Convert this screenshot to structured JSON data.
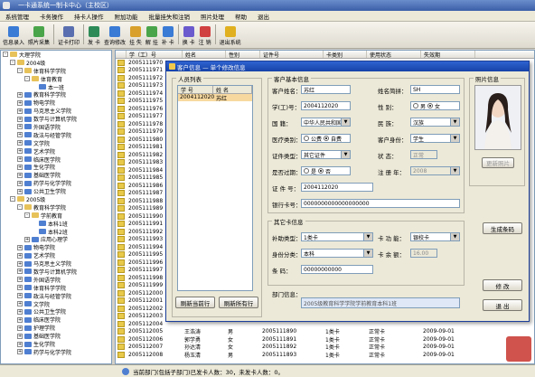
{
  "app": {
    "title": "一卡通系统一制卡中心（主校区）"
  },
  "menu": [
    "系统管理",
    "卡务操作",
    "持卡人操作",
    "附加功能",
    "批量挂失和注销",
    "照片处理",
    "帮助",
    "退出"
  ],
  "toolbar": [
    {
      "label": "信息录入",
      "icon": "user-add-icon",
      "color": "#3a7bd5"
    },
    {
      "label": "照片采集",
      "icon": "camera-icon",
      "color": "#4aa54a"
    },
    {
      "label": "证卡打印",
      "icon": "printer-icon",
      "color": "#5a6fb0"
    },
    {
      "label": "发 卡",
      "icon": "card-issue-icon",
      "color": "#2e8b57"
    },
    {
      "label": "查询修改",
      "icon": "search-icon",
      "color": "#3a7bd5"
    },
    {
      "label": "挂 失",
      "icon": "lock-icon",
      "color": "#d9a12b"
    },
    {
      "label": "解 挂",
      "icon": "unlock-icon",
      "color": "#4aa54a"
    },
    {
      "label": "补 卡",
      "icon": "card-replace-icon",
      "color": "#3a7bd5"
    },
    {
      "label": "换 卡",
      "icon": "card-swap-icon",
      "color": "#6a5acd"
    },
    {
      "label": "注 销",
      "icon": "cancel-icon",
      "color": "#d14040"
    },
    {
      "label": "退出系统",
      "icon": "key-exit-icon",
      "color": "#e0b020"
    }
  ],
  "tree": [
    {
      "text": "大理学院",
      "level": 0,
      "exp": "-"
    },
    {
      "text": "2004级",
      "level": 1,
      "exp": "-"
    },
    {
      "text": "体育科学学院",
      "level": 2,
      "exp": "-"
    },
    {
      "text": "体育教育",
      "level": 3,
      "exp": "-"
    },
    {
      "text": "本一班",
      "level": 4,
      "exp": ""
    },
    {
      "text": "教育科学学院",
      "level": 2,
      "exp": "+"
    },
    {
      "text": "物电学院",
      "level": 2,
      "exp": "+"
    },
    {
      "text": "马克思主义学院",
      "level": 2,
      "exp": "+"
    },
    {
      "text": "数学与计算机学院",
      "level": 2,
      "exp": "+"
    },
    {
      "text": "外国语学院",
      "level": 2,
      "exp": "+"
    },
    {
      "text": "政法与经管学院",
      "level": 2,
      "exp": "+"
    },
    {
      "text": "文学院",
      "level": 2,
      "exp": "+"
    },
    {
      "text": "艺术学院",
      "level": 2,
      "exp": "+"
    },
    {
      "text": "临床医学院",
      "level": 2,
      "exp": "+"
    },
    {
      "text": "生化学院",
      "level": 2,
      "exp": "+"
    },
    {
      "text": "基础医学院",
      "level": 2,
      "exp": "+"
    },
    {
      "text": "药学与化学学院",
      "level": 2,
      "exp": "+"
    },
    {
      "text": "公共卫生学院",
      "level": 2,
      "exp": "+"
    },
    {
      "text": "2005级",
      "level": 1,
      "exp": "-"
    },
    {
      "text": "教育科学学院",
      "level": 2,
      "exp": "-"
    },
    {
      "text": "学前教育",
      "level": 3,
      "exp": "-"
    },
    {
      "text": "本科1班",
      "level": 4,
      "exp": ""
    },
    {
      "text": "本科2班",
      "level": 4,
      "exp": ""
    },
    {
      "text": "应用心理学",
      "level": 3,
      "exp": "+"
    },
    {
      "text": "物电学院",
      "level": 2,
      "exp": "+"
    },
    {
      "text": "艺术学院",
      "level": 2,
      "exp": "+"
    },
    {
      "text": "马克思主义学院",
      "level": 2,
      "exp": "+"
    },
    {
      "text": "数学与计算机学院",
      "level": 2,
      "exp": "+"
    },
    {
      "text": "外国语学院",
      "level": 2,
      "exp": "+"
    },
    {
      "text": "体育科学学院",
      "level": 2,
      "exp": "+"
    },
    {
      "text": "政法与经管学院",
      "level": 2,
      "exp": "+"
    },
    {
      "text": "文学院",
      "level": 2,
      "exp": "+"
    },
    {
      "text": "公共卫生学院",
      "level": 2,
      "exp": "+"
    },
    {
      "text": "临床医学院",
      "level": 2,
      "exp": "+"
    },
    {
      "text": "护理学院",
      "level": 2,
      "exp": "+"
    },
    {
      "text": "基础医学院",
      "level": 2,
      "exp": "+"
    },
    {
      "text": "生化学院",
      "level": 2,
      "exp": "+"
    },
    {
      "text": "药学与化学学院",
      "level": 2,
      "exp": "+"
    }
  ],
  "grid": {
    "headers": [
      "学（工）号",
      "姓名",
      "性别",
      "证件号",
      "卡类别",
      "使用状态",
      "失效期"
    ],
    "ids": [
      "2005111970",
      "2005111971",
      "2005111972",
      "2005111973",
      "2005111974",
      "2005111975",
      "2005111976",
      "2005111977",
      "2005111978",
      "2005111979",
      "2005111980",
      "2005111981",
      "2005111982",
      "2005111983",
      "2005111984",
      "2005111985",
      "2005111986",
      "2005111987",
      "2005111988",
      "2005111989",
      "2005111990",
      "2005111991",
      "2005111992",
      "2005111993",
      "2005111994",
      "2005111995",
      "2005111996",
      "2005111997",
      "2005111998",
      "2005111999",
      "2005112000",
      "2005112001",
      "2005112002",
      "2005112003",
      "2005112004",
      "2005112005",
      "2005112006",
      "2005112007",
      "2005112008"
    ],
    "bottom_rows": [
      [
        "2005112005",
        "王浩涛",
        "男",
        "2005111890",
        "1类卡",
        "正常卡",
        "2009-09-01"
      ],
      [
        "2005112006",
        "郭学勇",
        "女",
        "2005111891",
        "1类卡",
        "正常卡",
        "2009-09-01"
      ],
      [
        "2005112007",
        "孙达清",
        "女",
        "2005111892",
        "1类卡",
        "正常卡",
        "2009-09-01"
      ],
      [
        "2005112008",
        "杨玉清",
        "男",
        "2005111893",
        "1类卡",
        "正常卡",
        "2009-09-01"
      ]
    ]
  },
  "status": {
    "text": "当前部门(包括子部门)已发卡人数：30，未发卡人数：0。"
  },
  "dialog": {
    "title": "客户信息 — 单个修改信息",
    "people_group": "人员列表",
    "people_cols": [
      "学 号",
      "姓 名"
    ],
    "people_rows": [
      [
        "2004112020",
        "苏红"
      ]
    ],
    "btn_refresh_current": "刷新当前行",
    "btn_refresh_all": "刷新所有行",
    "basic_group": "客户基本信息",
    "photo_group": "照片信息",
    "btn_update_photo": "更新照片",
    "labels": {
      "name": "客户姓名：",
      "alias": "姓名简拼：",
      "id": "学(工)号：",
      "gender": "性    别：",
      "nation": "国    籍：",
      "ethnic": "民    族：",
      "medical": "医疗类别：",
      "identity": "客户身份：",
      "idtype": "证件类型：",
      "state": "状    态：",
      "expire": "是否过期：",
      "validity": "注 册 年：",
      "idno": "证 件 号：",
      "bank": "银行卡号：",
      "other_group": "其它卡信息",
      "subsidy": "补助类型：",
      "cardfn": "卡 功 能：",
      "ident2": "身份分类：",
      "cardno": "卡 余 额：",
      "serial": "条    码：",
      "dept": "部门信息："
    },
    "values": {
      "name": "苏红",
      "alias": "SH",
      "id": "2004112020",
      "gender_male": "男",
      "gender_female": "女",
      "nation": "中华人民共和国",
      "ethnic": "汉族",
      "medical_a": "公费",
      "medical_b": "自费",
      "identity": "学生",
      "idtype": "其它证件",
      "state": "正常",
      "expire_yes": "是",
      "expire_no": "否",
      "validity": "2008",
      "idno": "2004112020",
      "bank": "0000000000000000000",
      "subsidy": "1类卡",
      "cardfn": "银校卡",
      "ident2": "本科",
      "cardno": "16.00",
      "serial": "00000000000",
      "dept": "2005级教育科学学院学前教育本科1班"
    },
    "btn_gen_barcode": "生成条码",
    "btn_modify": "修 改",
    "btn_exit": "退 出"
  }
}
